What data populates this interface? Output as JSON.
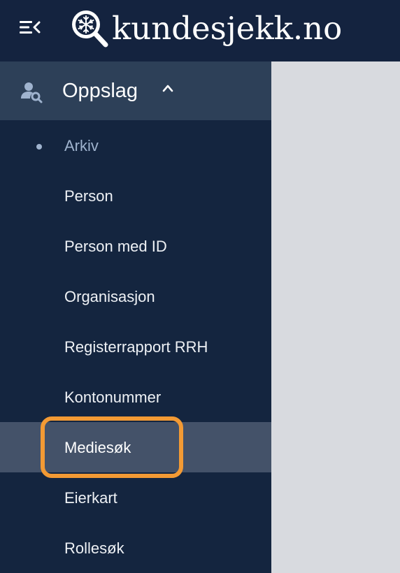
{
  "header": {
    "logo_text": "kundesjekk.no",
    "menu_icon": "menu-collapse-icon",
    "logo_icon": "snowflake-magnifier-icon"
  },
  "sidebar": {
    "section": {
      "label": "Oppslag",
      "icon": "user-search-icon",
      "chevron": "chevron-up-icon"
    },
    "items": [
      {
        "label": "Arkiv",
        "current": true
      },
      {
        "label": "Person"
      },
      {
        "label": "Person med ID"
      },
      {
        "label": "Organisasjon"
      },
      {
        "label": "Registerrapport RRH"
      },
      {
        "label": "Kontonummer"
      },
      {
        "label": "Mediesøk",
        "active": true
      },
      {
        "label": "Eierkart"
      },
      {
        "label": "Rollesøk"
      }
    ]
  },
  "colors": {
    "topbar": "#14233f",
    "sidebar": "#14253f",
    "section_header": "#2d4058",
    "active_item": "#445269",
    "current_item_text": "#9fb3ce",
    "content_bg": "#d8dadf",
    "highlight_ring": "#f39a34"
  }
}
